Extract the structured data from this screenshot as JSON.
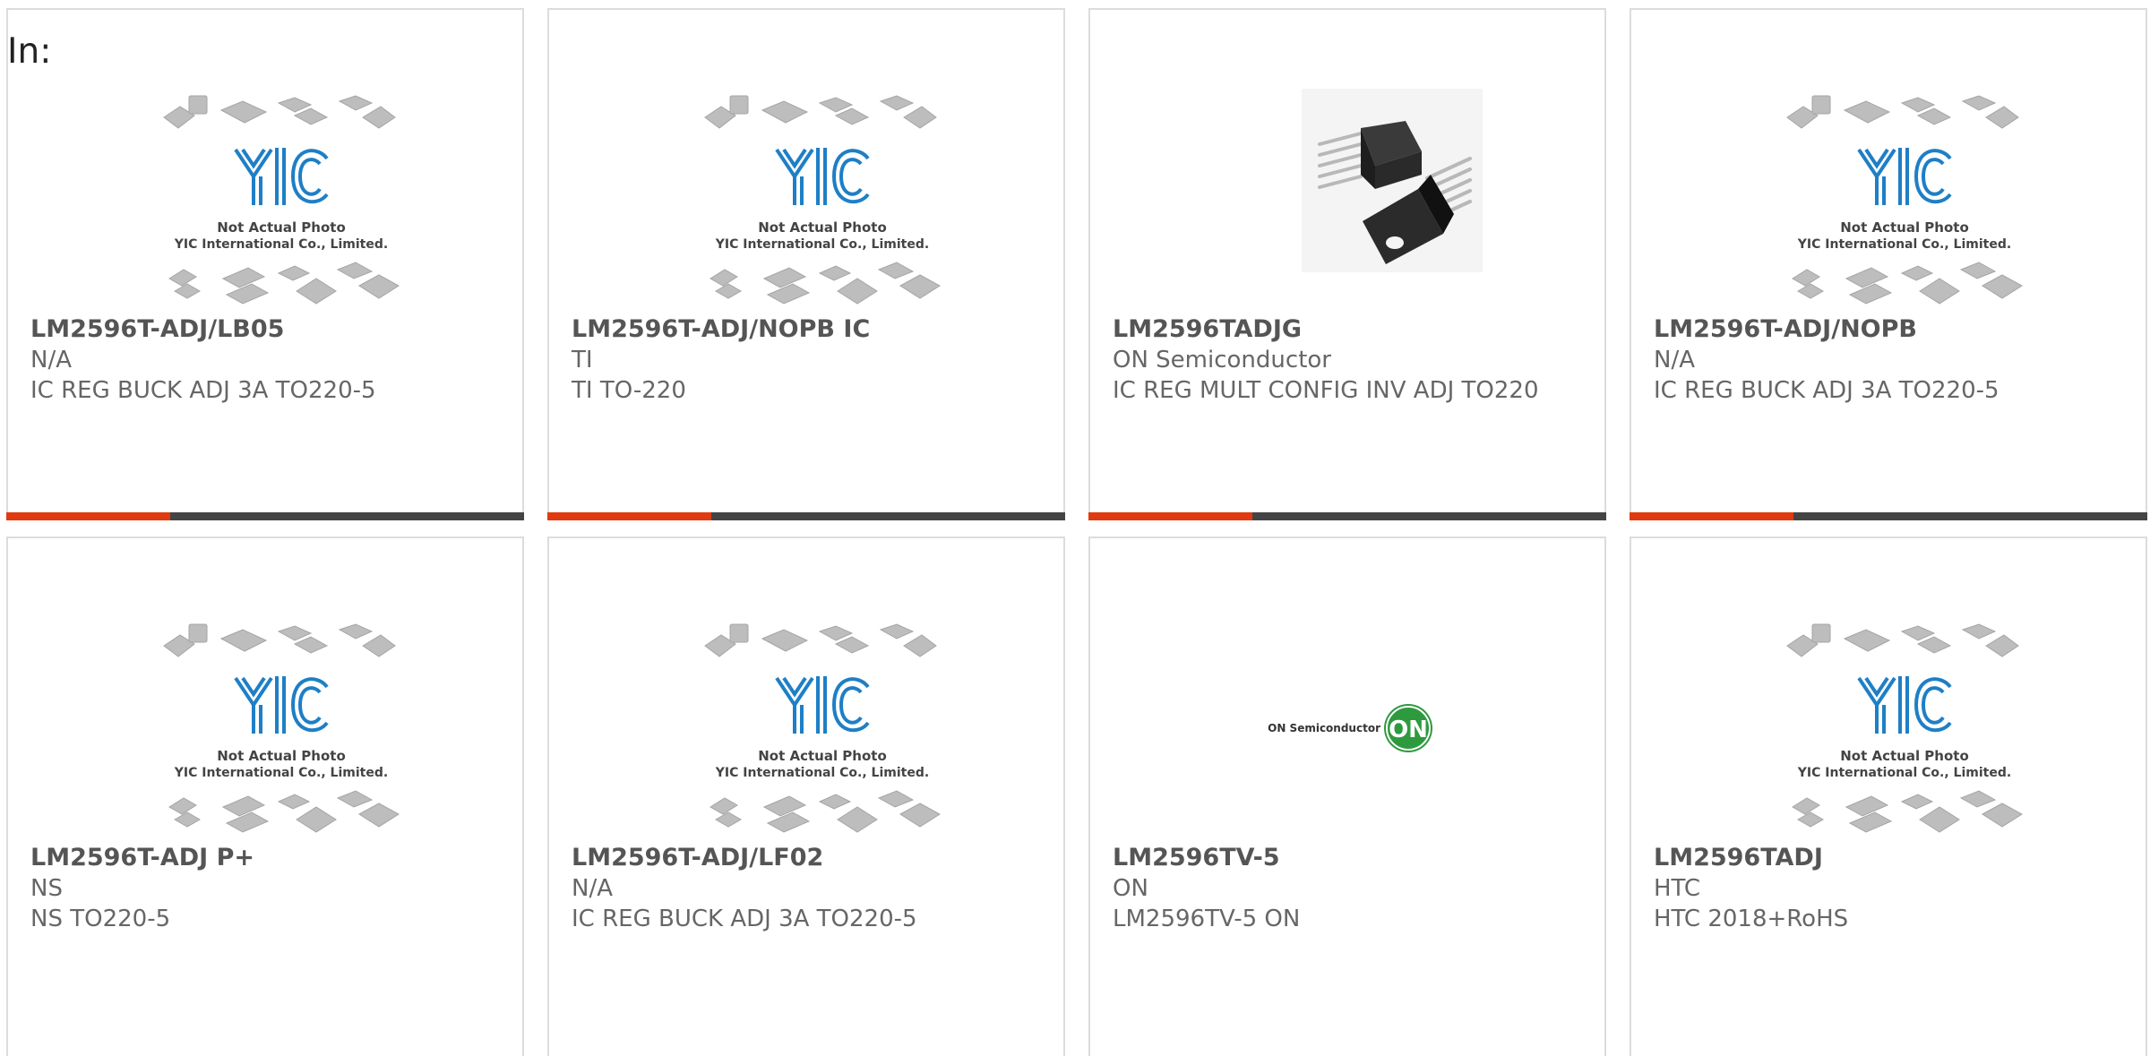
{
  "header": {
    "in_label": "In:"
  },
  "placeholder_text": {
    "line1": "Not Actual Photo",
    "line2": "YIC International Co., Limited.",
    "logo": "YIC"
  },
  "on_logo": {
    "text": "ON Semiconductor",
    "badge": "ON",
    "color": "#2e9a3e"
  },
  "colors": {
    "accent": "#e03a10",
    "bar": "#444444",
    "card_border": "#dcdcdc",
    "yic_blue": "#1e7fc6"
  },
  "products": [
    {
      "part_number": "LM2596T-ADJ/LB05",
      "manufacturer": "N/A",
      "description": "IC REG BUCK ADJ 3A TO220-5",
      "image": "yic-placeholder-icon"
    },
    {
      "part_number": "LM2596T-ADJ/NOPB IC",
      "manufacturer": "TI",
      "description": "TI TO-220",
      "image": "yic-placeholder-icon"
    },
    {
      "part_number": "LM2596TADJG",
      "manufacturer": "ON Semiconductor",
      "description": "IC REG MULT CONFIG INV ADJ TO220",
      "image": "to220-package-icon"
    },
    {
      "part_number": "LM2596T-ADJ/NOPB",
      "manufacturer": "N/A",
      "description": "IC REG BUCK ADJ 3A TO220-5",
      "image": "yic-placeholder-icon"
    },
    {
      "part_number": "LM2596T-ADJ P+",
      "manufacturer": "NS",
      "description": "NS TO220-5",
      "image": "yic-placeholder-icon"
    },
    {
      "part_number": "LM2596T-ADJ/LF02",
      "manufacturer": "N/A",
      "description": "IC REG BUCK ADJ 3A TO220-5",
      "image": "yic-placeholder-icon"
    },
    {
      "part_number": "LM2596TV-5",
      "manufacturer": "ON",
      "description": "LM2596TV-5 ON",
      "image": "on-semiconductor-logo-icon"
    },
    {
      "part_number": "LM2596TADJ",
      "manufacturer": "HTC",
      "description": "HTC 2018+RoHS",
      "image": "yic-placeholder-icon"
    }
  ]
}
